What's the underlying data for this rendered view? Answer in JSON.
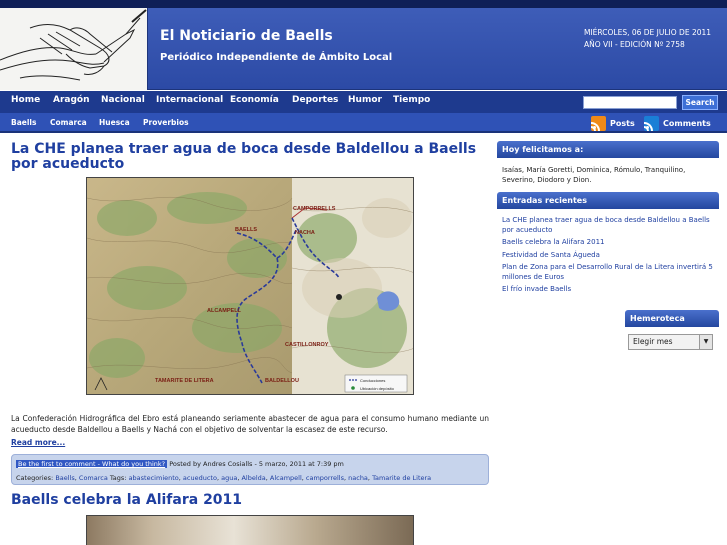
{
  "site": {
    "title": "El Noticiario de Baells",
    "tagline": "Periódico Independiente de Ámbito Local",
    "date": "MIÉRCOLES, 06 DE JULIO DE 2011",
    "edition": "AÑO VII - EDICIÓN Nº 2758"
  },
  "main_nav": [
    "Home",
    "Aragón",
    "Nacional",
    "Internacional",
    "Economía",
    "Deportes",
    "Humor",
    "Tiempo"
  ],
  "search": {
    "placeholder": "",
    "button_label": "Search"
  },
  "sub_nav": [
    "Baells",
    "Comarca",
    "Huesca",
    "Proverbios"
  ],
  "feeds": {
    "posts_label": "Posts",
    "comments_label": "Comments"
  },
  "post1": {
    "title": "La CHE planea traer agua de boca desde Baldellou a Baells por acueducto",
    "map_labels": {
      "camporrells": "CAMPORRELLS",
      "baells": "BAELLS",
      "nacha": "NACHA",
      "alcampell": "ALCAMPELL",
      "castillonroy": "CASTILLONROY",
      "tamarite": "TAMARITE DE LITERA",
      "baldellou": "BALDELLOU",
      "legend1": "Conducciones",
      "legend2": "Ubicación depósito"
    },
    "excerpt": "La Confederación Hidrográfica del Ebro está planeando seriamente abastecer de agua para el consumo humano mediante un acueducto desde Baldellou a Baells y Nachá con el objetivo de solventar la escasez de este recurso.",
    "read_more": "Read more...",
    "comment_link": "Be the first to comment - What do you think?",
    "posted_by": "Posted by Andres Cosialls - 5 marzo, 2011 at 7:39 pm",
    "categories_label": "Categories:",
    "categories": [
      "Baells",
      "Comarca"
    ],
    "tags_label": "Tags:",
    "tags": [
      "abastecimiento",
      "acueducto",
      "agua",
      "Albelda",
      "Alcampell",
      "camporrells",
      "nacha",
      "Tamarite de Litera"
    ]
  },
  "post2": {
    "title": "Baells celebra la Alifara 2011"
  },
  "sidebar": {
    "congrats_title": "Hoy felicitamos a:",
    "congrats_text": "Isaías, María Goretti, Dominica, Rómulo, Tranquilino, Severino, Diodoro y Dion.",
    "recent_title": "Entradas recientes",
    "recent": [
      "La CHE planea traer agua de boca desde Baldellou a Baells por acueducto",
      "Baells celebra la Alifara 2011",
      "Festividad de Santa Águeda",
      "Plan de Zona para el Desarrollo Rural de la Litera invertirá 5 millones de Euros",
      "El frío invade Baells"
    ],
    "archive_title": "Hemeroteca",
    "archive_select": "Elegir mes"
  }
}
